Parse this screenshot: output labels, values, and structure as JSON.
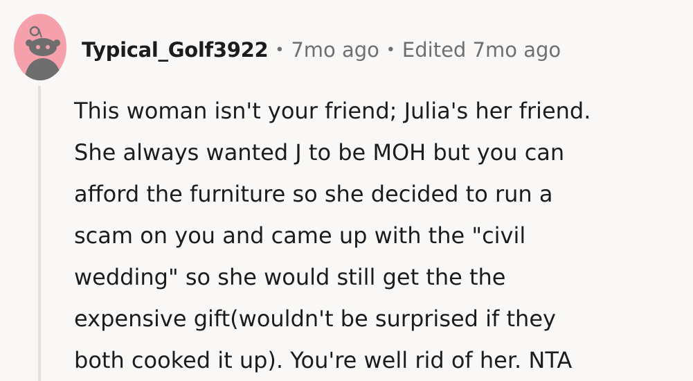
{
  "comment": {
    "author": "Typical_Golf3922",
    "separator": "•",
    "age": "7mo ago",
    "edited": "Edited 7mo ago",
    "body_lines": [
      "This woman isn't your friend; Julia's her friend.",
      "She always wanted J to be MOH but you can",
      "afford the furniture so she decided to run a",
      "scam on you and came up with the \"civil",
      "wedding\" so she would still get the the",
      "expensive gift(wouldn't be surprised if they",
      "both cooked it up). You're well rid of her. NTA"
    ]
  },
  "avatar": {
    "icon": "reddit-snoo-avatar-icon",
    "background_color": "#f5a0ab",
    "figure_color": "#6e6e6e"
  }
}
